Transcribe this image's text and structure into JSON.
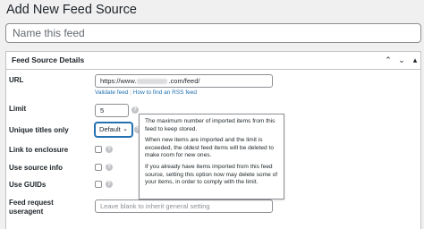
{
  "page": {
    "title": "Add New Feed Source"
  },
  "name_field": {
    "placeholder": "Name this feed"
  },
  "metabox": {
    "title": "Feed Source Details",
    "controls": {
      "up": "⌃",
      "down": "⌄",
      "toggle": "▴"
    }
  },
  "fields": {
    "url": {
      "label": "URL",
      "value_prefix": "https://www.",
      "value_suffix": ".com/feed/",
      "validate_link": "Validate feed",
      "separator": "|",
      "rss_link": "How to find an RSS feed"
    },
    "limit": {
      "label": "Limit",
      "value": "5"
    },
    "unique_titles": {
      "label": "Unique titles only",
      "selected": "Default"
    },
    "link_enclosure": {
      "label": "Link to enclosure"
    },
    "source_info": {
      "label": "Use source info"
    },
    "guids": {
      "label": "Use GUIDs"
    },
    "useragent": {
      "label_line1": "Feed request",
      "label_line2": "useragent",
      "placeholder": "Leave blank to inherit general setting"
    }
  },
  "help_icon": "?",
  "tooltip": {
    "p1": "The maximum number of imported items from this feed to keep stored.",
    "p2": "When new items are imported and the limit is exceeded, the oldest feed items will be deleted to make room for new ones.",
    "p3": "If you already have items imported from this feed source, setting this option now may delete some of your items, in order to comply with the limit."
  }
}
